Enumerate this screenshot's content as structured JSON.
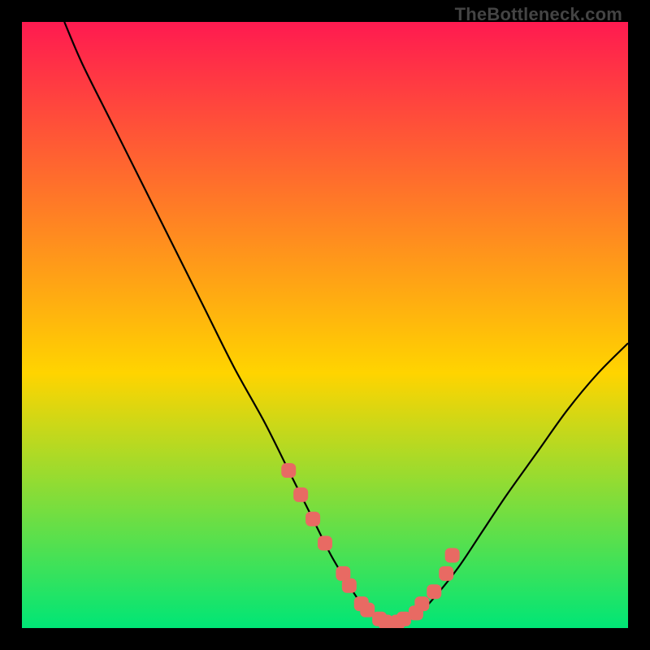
{
  "watermark": "TheBottleneck.com",
  "chart_data": {
    "type": "line",
    "title": "",
    "xlabel": "",
    "ylabel": "",
    "xlim": [
      0,
      100
    ],
    "ylim": [
      0,
      100
    ],
    "background_gradient": {
      "top": "#ff1a50",
      "mid": "#ffd400",
      "bottom": "#00e676"
    },
    "series": [
      {
        "name": "curve",
        "type": "line",
        "color": "#000000",
        "x": [
          7,
          10,
          15,
          20,
          25,
          30,
          35,
          40,
          44,
          48,
          51,
          54,
          56,
          58,
          60,
          62,
          65,
          68,
          72,
          76,
          80,
          85,
          90,
          95,
          100
        ],
        "y": [
          100,
          93,
          83,
          73,
          63,
          53,
          43,
          34,
          26,
          18,
          12,
          7,
          4,
          2,
          1,
          1,
          2,
          5,
          10,
          16,
          22,
          29,
          36,
          42,
          47
        ]
      },
      {
        "name": "marker-points",
        "type": "scatter",
        "color": "#e86a63",
        "x": [
          44,
          46,
          48,
          50,
          53,
          54,
          56,
          57,
          59,
          60,
          62,
          63,
          65,
          66,
          68,
          70,
          71
        ],
        "y": [
          26,
          22,
          18,
          14,
          9,
          7,
          4,
          3,
          1.5,
          1,
          1,
          1.5,
          2.5,
          4,
          6,
          9,
          12
        ]
      }
    ]
  }
}
